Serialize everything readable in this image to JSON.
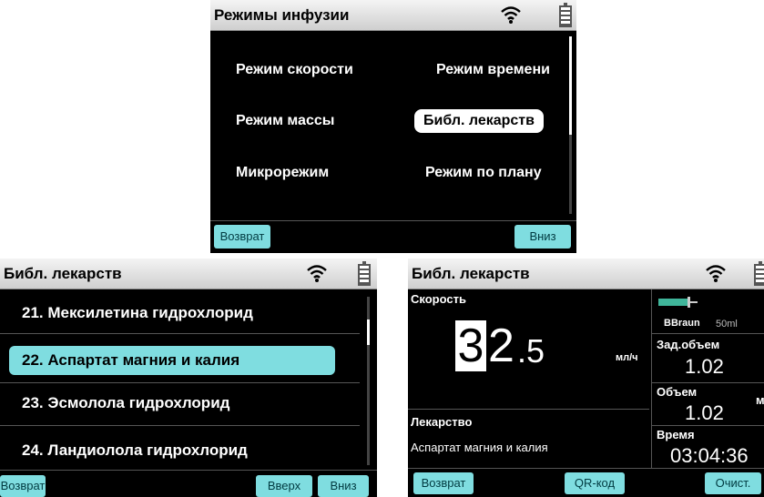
{
  "modes_screen": {
    "title": "Режимы инфузии",
    "items": [
      {
        "label": "Режим скорости"
      },
      {
        "label": "Режим времени"
      },
      {
        "label": "Режим массы"
      },
      {
        "label": "Библ. лекарств"
      },
      {
        "label": "Микрорежим"
      },
      {
        "label": "Режим по плану"
      }
    ],
    "selected": "Библ. лекарств",
    "back_label": "Возврат",
    "down_label": "Вниз"
  },
  "library_screen": {
    "title": "Библ. лекарств",
    "items": [
      {
        "label": "21. Мексилетина гидрохлорид"
      },
      {
        "label": "22. Аспартат магния и калия"
      },
      {
        "label": "23. Эсмолола гидрохлорид"
      },
      {
        "label": "24. Ландиолола гидрохлорид"
      }
    ],
    "selected_index": 1,
    "back_label": "Возврат",
    "up_label": "Вверх",
    "down_label": "Вниз"
  },
  "detail_screen": {
    "title": "Библ. лекарств",
    "speed_label": "Скорость",
    "speed_digit_highlight": "3",
    "speed_rest": "2",
    "speed_decimal": ".5",
    "speed_unit": "мл/ч",
    "drug_label": "Лекарство",
    "drug_name": "Аспартат магния и калия",
    "syringe_brand": "BBraun",
    "syringe_size": "50ml",
    "target_volume_label": "Зад.объем",
    "target_volume_value": "1.02",
    "volume_label": "Объем",
    "volume_value": "1.02",
    "volume_unit_partial": "м",
    "time_label": "Время",
    "time_value": "03:04:36",
    "back_label": "Возврат",
    "qr_label": "QR-код",
    "clear_label": "Очист."
  },
  "colors": {
    "accent": "#7fdde0",
    "screen_bg": "#000000"
  }
}
